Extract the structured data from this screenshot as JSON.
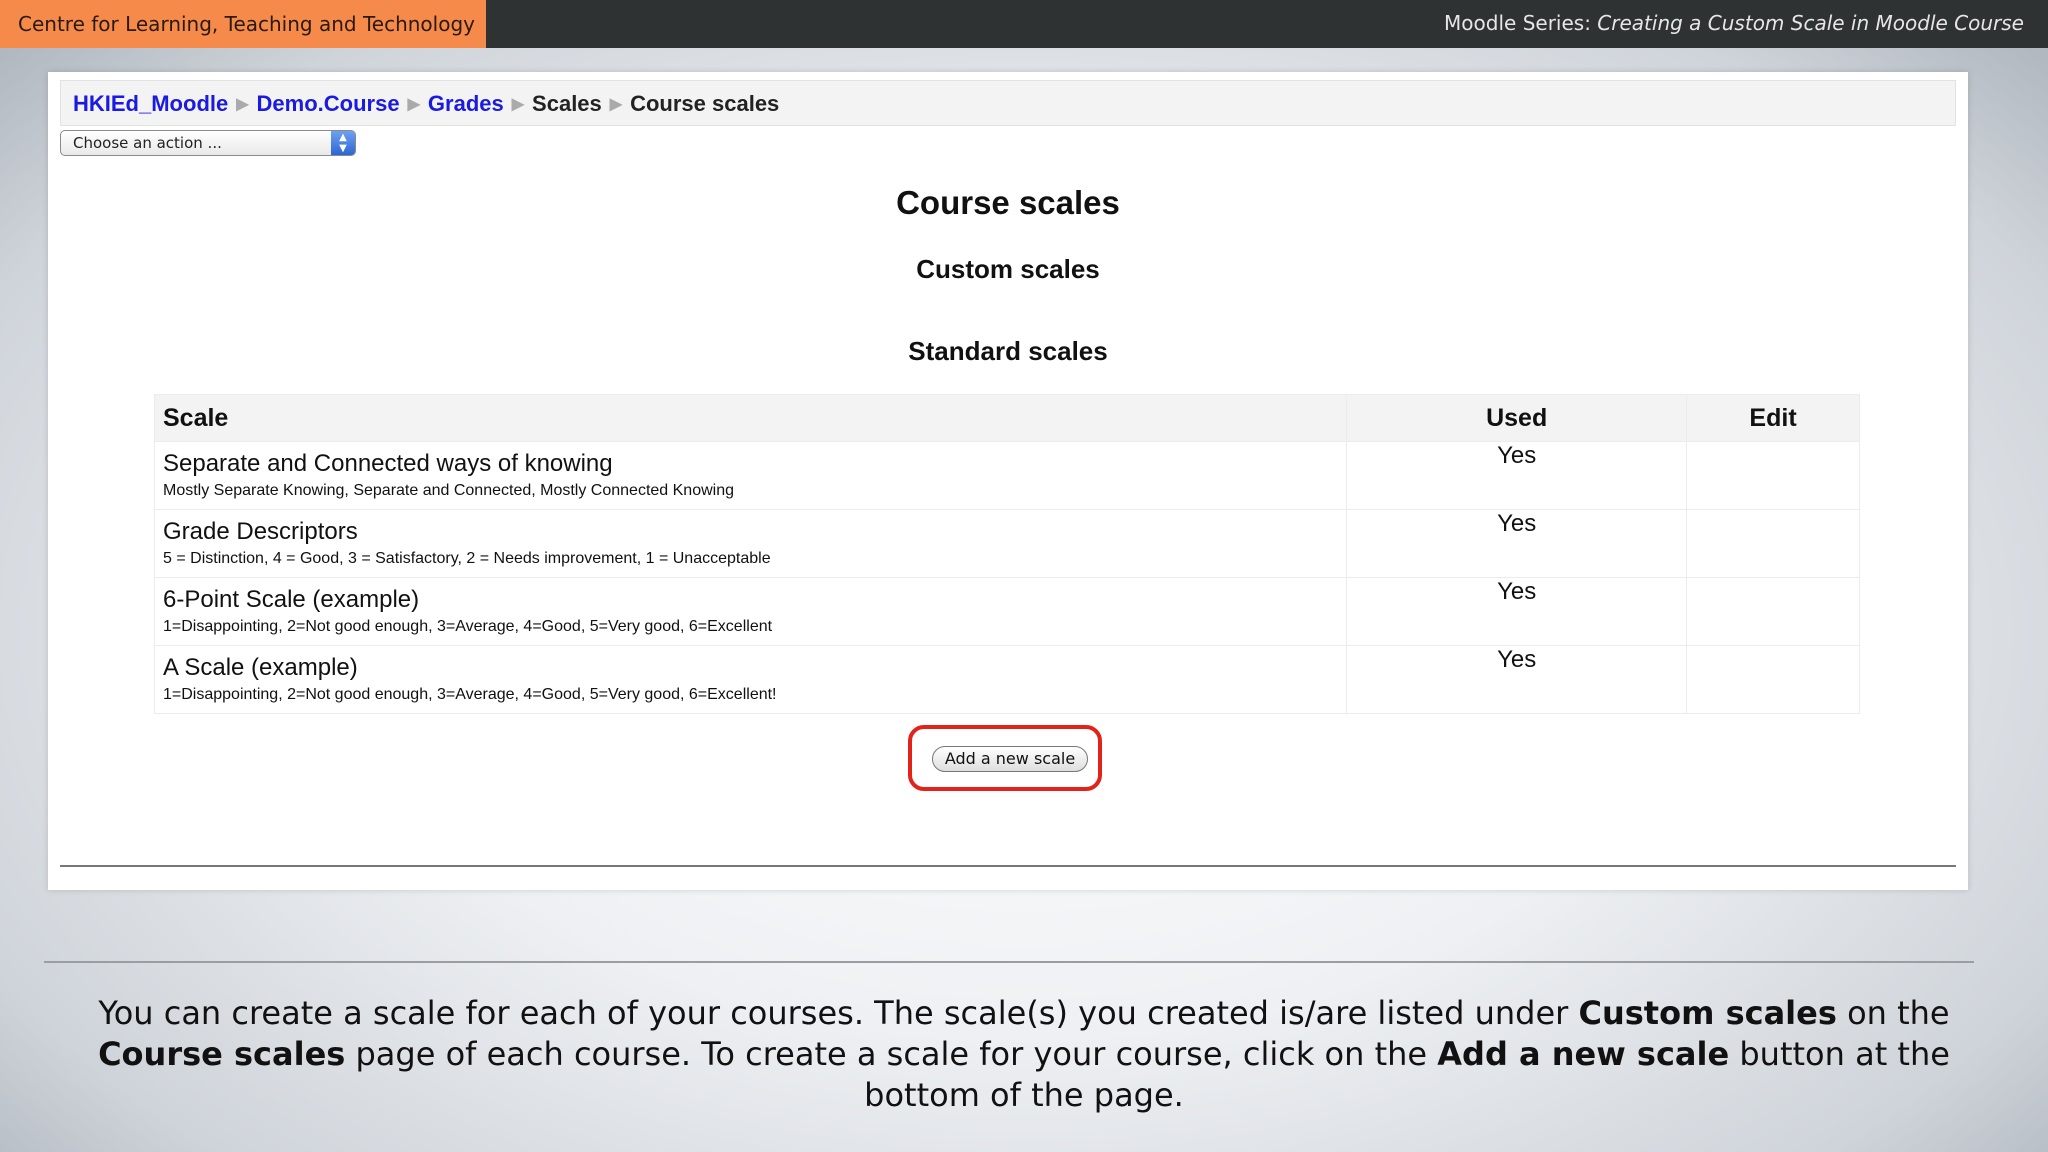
{
  "header": {
    "org": "Centre for Learning, Teaching and Technology",
    "series_prefix": "Moodle Series:",
    "series_title": "Creating a Custom Scale in Moodle Course"
  },
  "breadcrumb": {
    "items": [
      "HKIEd_Moodle",
      "Demo.Course",
      "Grades",
      "Scales",
      "Course scales"
    ],
    "separator": "▶"
  },
  "jump_menu": {
    "value": "Choose an action ..."
  },
  "page": {
    "title": "Course scales",
    "custom_heading": "Custom scales",
    "standard_heading": "Standard scales"
  },
  "table": {
    "headers": [
      "Scale",
      "Used",
      "Edit"
    ],
    "rows": [
      {
        "name": "Separate and Connected ways of knowing",
        "desc": "Mostly Separate Knowing, Separate and Connected, Mostly Connected Knowing",
        "used": "Yes",
        "edit": ""
      },
      {
        "name": "Grade Descriptors",
        "desc": "5 = Distinction, 4 = Good, 3 = Satisfactory, 2 = Needs improvement, 1 = Unacceptable",
        "used": "Yes",
        "edit": ""
      },
      {
        "name": "6-Point Scale (example)",
        "desc": "1=Disappointing, 2=Not good enough, 3=Average, 4=Good, 5=Very good, 6=Excellent",
        "used": "Yes",
        "edit": ""
      },
      {
        "name": "A Scale (example)",
        "desc": "1=Disappointing, 2=Not good enough, 3=Average, 4=Good, 5=Very good, 6=Excellent!",
        "used": "Yes",
        "edit": ""
      }
    ]
  },
  "add_button": {
    "label": "Add a new scale"
  },
  "caption": {
    "p1": "You can create a scale for each of your courses. The scale(s) you created is/are listed under ",
    "b1": "Custom scales",
    "p2": " on the ",
    "b2": "Course scales",
    "p3": " page of each course. To create a scale for your course, click on the ",
    "b3": "Add a new scale",
    "p4": " button at the bottom of the page."
  },
  "colors": {
    "accent": "#f58a4a",
    "link": "#1a1ae0",
    "highlight": "#e2231a",
    "topbar": "#2f3233"
  }
}
